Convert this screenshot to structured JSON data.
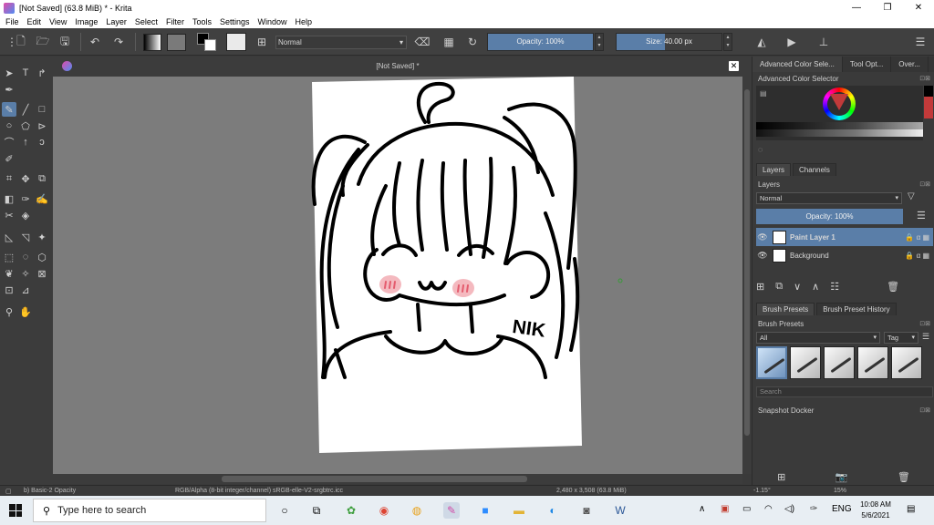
{
  "window": {
    "title": "[Not Saved]  (63.8 MiB)  * - Krita",
    "minimize": "—",
    "maximize": "❐",
    "close": "✕"
  },
  "menu": [
    "File",
    "Edit",
    "View",
    "Image",
    "Layer",
    "Select",
    "Filter",
    "Tools",
    "Settings",
    "Window",
    "Help"
  ],
  "toolbar": {
    "blend_mode": "Normal",
    "opacity_label": "Opacity: 100%",
    "size_label": "Size: 40.00 px",
    "size_fill_fraction": 0.46
  },
  "document": {
    "tab_title": "[Not Saved]  *",
    "close": "✕"
  },
  "dockers": {
    "tabs": [
      "Advanced Color Sele...",
      "Tool Opt...",
      "Over..."
    ],
    "color_selector_title": "Advanced Color Selector",
    "layer_tabs": [
      "Layers",
      "Channels"
    ],
    "layers_title": "Layers",
    "layer_blend_mode": "Normal",
    "layer_opacity": "Opacity:  100%",
    "layers": [
      {
        "name": "Paint Layer 1",
        "selected": true
      },
      {
        "name": "Background",
        "selected": false
      }
    ],
    "preset_tabs": [
      "Brush Presets",
      "Brush Preset History"
    ],
    "presets_title": "Brush Presets",
    "preset_filter": "All",
    "tag_label": "Tag",
    "search_placeholder": "Search",
    "snapshot_title": "Snapshot Docker"
  },
  "status": {
    "brush": "b) Basic-2 Opacity",
    "color_space": "RGB/Alpha (8-bit integer/channel)  sRGB-elle-V2-srgbtrc.icc",
    "image_size": "2,480 x 3,508 (63.8 MiB)",
    "rotation": "-1.15°",
    "zoom": "15%"
  },
  "taskbar": {
    "search_placeholder": "Type here to search",
    "language": "ENG",
    "time": "10:08 AM",
    "date": "5/6/2021"
  },
  "artwork": {
    "signature": "NIK"
  },
  "colors": {
    "accent": "#5a7ea8",
    "panel": "#3a3a3a",
    "canvas_bg": "#7c7c7c"
  }
}
